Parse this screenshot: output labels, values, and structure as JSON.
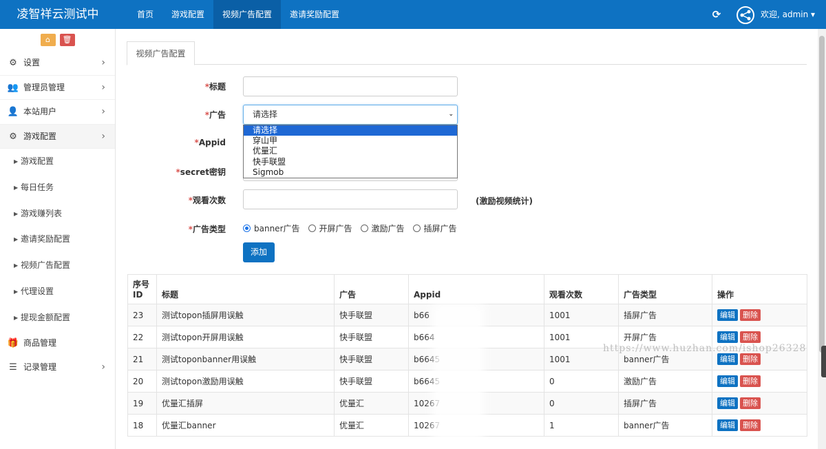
{
  "app": {
    "title": "凌智祥云测试中"
  },
  "nav": [
    {
      "label": "首页",
      "active": false
    },
    {
      "label": "游戏配置",
      "active": false
    },
    {
      "label": "视频广告配置",
      "active": true
    },
    {
      "label": "邀请奖励配置",
      "active": false
    }
  ],
  "user": {
    "greeting": "欢迎, admin ▾"
  },
  "sidebar": {
    "menu": [
      {
        "label": "设置",
        "icon": "gears-icon"
      },
      {
        "label": "管理员管理",
        "icon": "users-icon"
      },
      {
        "label": "本站用户",
        "icon": "user-icon"
      },
      {
        "label": "游戏配置",
        "icon": "gears-icon"
      }
    ],
    "submenu": [
      "游戏配置",
      "每日任务",
      "游戏赚列表",
      "邀请奖励配置",
      "视频广告配置",
      "代理设置",
      "提现金额配置"
    ],
    "bottom": [
      {
        "label": "商品管理",
        "icon": "gift-icon"
      },
      {
        "label": "记录管理",
        "icon": "list-icon"
      }
    ]
  },
  "tab": "视频广告配置",
  "form": {
    "required_mark": "*",
    "title_label": "标题",
    "ad_label": "广告",
    "appid_label": "Appid",
    "secret_label": "secret密钥",
    "views_label": "观看次数",
    "views_hint": "(激励视频统计)",
    "type_label": "广告类型",
    "ad_select": {
      "value": "请选择",
      "options": [
        "请选择",
        "穿山甲",
        "优量汇",
        "快手联盟",
        "Sigmob"
      ]
    },
    "types": [
      "banner广告",
      "开屏广告",
      "激励广告",
      "插屏广告"
    ],
    "type_selected": "banner广告",
    "add_button": "添加"
  },
  "table": {
    "headers": [
      "序号ID",
      "标题",
      "广告",
      "Appid",
      "观看次数",
      "广告类型",
      "操作"
    ],
    "header_id_line1": "序号",
    "header_id_line2": "ID",
    "edit_label": "编辑",
    "delete_label": "删除",
    "rows": [
      {
        "id": "23",
        "title": "测试topon插屏用误触",
        "ad": "快手联盟",
        "appid": "b66",
        "views": "1001",
        "type": "插屏广告"
      },
      {
        "id": "22",
        "title": "测试topon开屏用误触",
        "ad": "快手联盟",
        "appid": "b664",
        "views": "1001",
        "type": "开屏广告"
      },
      {
        "id": "21",
        "title": "测试toponbanner用误触",
        "ad": "快手联盟",
        "appid": "b6645",
        "views": "1001",
        "type": "banner广告"
      },
      {
        "id": "20",
        "title": "测试topon激励用误触",
        "ad": "快手联盟",
        "appid": "b6645",
        "views": "0",
        "type": "激励广告"
      },
      {
        "id": "19",
        "title": "优量汇插屏",
        "ad": "优量汇",
        "appid": "10267",
        "views": "0",
        "type": "插屏广告"
      },
      {
        "id": "18",
        "title": "优量汇banner",
        "ad": "优量汇",
        "appid": "10267",
        "views": "1",
        "type": "banner广告"
      }
    ]
  },
  "watermark": "https://www.huzhan.com/ishop26328"
}
